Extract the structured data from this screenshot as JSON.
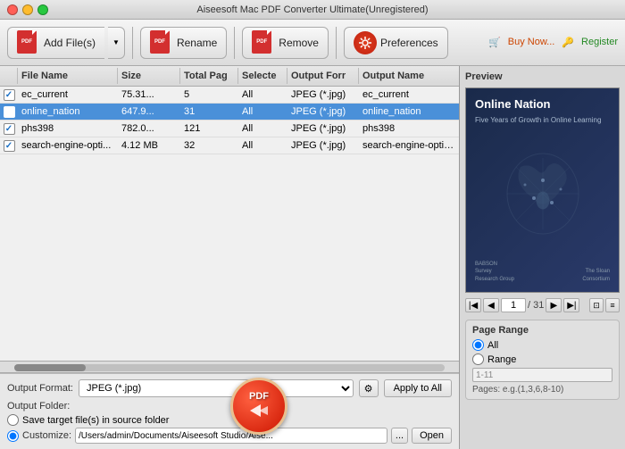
{
  "window": {
    "title": "Aiseesoft Mac PDF Converter Ultimate(Unregistered)"
  },
  "toolbar": {
    "add_files_label": "Add File(s)",
    "rename_label": "Rename",
    "remove_label": "Remove",
    "preferences_label": "Preferences",
    "buy_label": "Buy Now...",
    "register_label": "Register"
  },
  "table": {
    "headers": [
      "",
      "File Name",
      "Size",
      "Total Pag",
      "Selecte",
      "Output Forr",
      "Output Name"
    ],
    "rows": [
      {
        "checked": true,
        "name": "ec_current",
        "size": "75.31...",
        "pages": "5",
        "select": "All",
        "format": "JPEG (*.jpg)",
        "output": "ec_current",
        "selected": false
      },
      {
        "checked": true,
        "name": "online_nation",
        "size": "647.9...",
        "pages": "31",
        "select": "All",
        "format": "JPEG (*.jpg)",
        "output": "online_nation",
        "selected": true
      },
      {
        "checked": true,
        "name": "phs398",
        "size": "782.0...",
        "pages": "121",
        "select": "All",
        "format": "JPEG (*.jpg)",
        "output": "phs398",
        "selected": false
      },
      {
        "checked": true,
        "name": "search-engine-opti...",
        "size": "4.12 MB",
        "pages": "32",
        "select": "All",
        "format": "JPEG (*.jpg)",
        "output": "search-engine-optimizati...",
        "selected": false
      }
    ]
  },
  "bottom": {
    "output_format_label": "Output Format:",
    "format_value": "JPEG (*.jpg)",
    "apply_to_all_label": "Apply to All",
    "output_folder_label": "Output Folder:",
    "save_source_label": "Save target file(s) in source folder",
    "customize_label": "Customize:",
    "path_value": "/Users/admin/Documents/Aiseesoft Studio/Aise...",
    "dots_label": "...",
    "open_label": "Open"
  },
  "preview": {
    "label": "Preview",
    "book_title": "Online Nation",
    "book_subtitle": "Five Years of Growth in Online Learning",
    "current_page": "1",
    "total_pages": "/ 31"
  },
  "page_range": {
    "title": "Page Range",
    "all_label": "All",
    "range_label": "Range",
    "range_value": "1-11",
    "pages_hint": "Pages: e.g.(1,3,6,8-10)"
  }
}
